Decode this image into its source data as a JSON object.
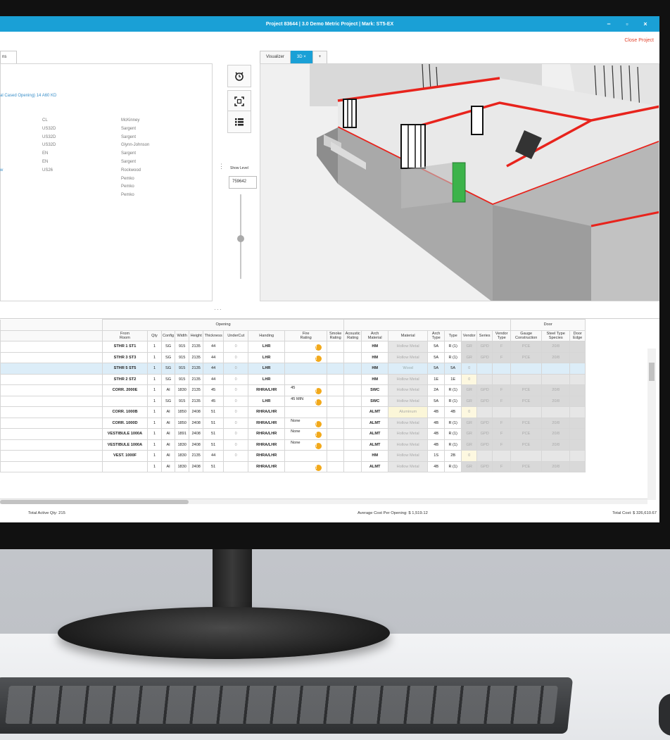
{
  "window": {
    "title": "Project 83644 | 3.0 Demo Metric Project | Mark: ST5-EX",
    "close_project": "Close Project",
    "minimize": "−",
    "maximize": "▫",
    "close": "×"
  },
  "left_panel": {
    "tab_label": "ns",
    "opening_link": "al Cased Opening) 14 A60 KD",
    "hardware": [
      {
        "finish": "CL",
        "mfr": "McKinney"
      },
      {
        "finish": "US32D",
        "mfr": "Sargent"
      },
      {
        "finish": "US32D",
        "mfr": "Sargent"
      },
      {
        "finish": "US32D",
        "mfr": "Glynn-Johnson"
      },
      {
        "finish": "EN",
        "mfr": "Sargent"
      },
      {
        "finish": "EN",
        "mfr": "Sargent"
      },
      {
        "finish": "US26",
        "mfr": "Rockwood",
        "lead": "w"
      },
      {
        "finish": "",
        "mfr": "Pemko"
      },
      {
        "finish": "",
        "mfr": "Pemko"
      },
      {
        "finish": "",
        "mfr": "Pemko"
      }
    ]
  },
  "tools": {
    "show_level_label": "Show Level",
    "show_level_value": "759642"
  },
  "visualizer": {
    "tabs": [
      "Visualizer",
      "3D ×",
      "+"
    ],
    "active_tab": 1
  },
  "table": {
    "group_opening": "Opening",
    "group_door": "Door",
    "headers": [
      "From\nRoom",
      "Qty",
      "Config",
      "Width",
      "Height",
      "Thickness",
      "UnderCut",
      "Handing",
      "Fire\nRating",
      "Smoke\nRating",
      "Acoustic\nRating",
      "Arch\nMaterial",
      "Material",
      "Arch\nType",
      "Type",
      "Vendor",
      "Series",
      "Vendor\nType",
      "Gauge\nConstruction",
      "Steel Type\nSpecies",
      "Door\nEdge"
    ],
    "rows": [
      {
        "from_room": "STHR 1 ST1",
        "qty": "1",
        "config": "SG",
        "width": "915",
        "height": "2135",
        "thickness": "44",
        "undercut": "0",
        "handing": "LHR",
        "fire": "",
        "fire_warn": true,
        "smoke": "",
        "acoustic": "",
        "arch_material": "HM",
        "material": "Hollow Metal",
        "arch_type": "5A",
        "type": "R (1)",
        "vendor": "GR",
        "series": "GPD",
        "vendor_type": "F",
        "gauge": "PCE",
        "steel": "20/8",
        "edge": "",
        "style": "gray"
      },
      {
        "from_room": "STHR 3 ST3",
        "qty": "1",
        "config": "SG",
        "width": "915",
        "height": "2135",
        "thickness": "44",
        "undercut": "0",
        "handing": "LHR",
        "fire": "",
        "fire_warn": true,
        "smoke": "",
        "acoustic": "",
        "arch_material": "HM",
        "material": "Hollow Metal",
        "arch_type": "5A",
        "type": "R (1)",
        "vendor": "GR",
        "series": "GPD",
        "vendor_type": "F",
        "gauge": "PCE",
        "steel": "20/8",
        "edge": "",
        "style": "gray"
      },
      {
        "from_room": "STHR 5 ST5",
        "qty": "1",
        "config": "SG",
        "width": "915",
        "height": "2135",
        "thickness": "44",
        "undercut": "0",
        "handing": "LHR",
        "fire": "",
        "fire_warn": false,
        "smoke": "",
        "acoustic": "",
        "arch_material": "HM",
        "material": "Wood",
        "arch_type": "5A",
        "type": "5A",
        "vendor": "0",
        "series": "",
        "vendor_type": "",
        "gauge": "",
        "steel": "",
        "edge": "",
        "style": "sel"
      },
      {
        "from_room": "STHR 2 ST2",
        "qty": "1",
        "config": "SG",
        "width": "915",
        "height": "2135",
        "thickness": "44",
        "undercut": "0",
        "handing": "LHR",
        "fire": "",
        "fire_warn": false,
        "smoke": "",
        "acoustic": "",
        "arch_material": "HM",
        "material": "Hollow Metal",
        "arch_type": "1E",
        "type": "1E",
        "vendor": "0",
        "series": "",
        "vendor_type": "",
        "gauge": "",
        "steel": "",
        "edge": "",
        "style": "plain"
      },
      {
        "from_room": "CORR. 2000E",
        "qty": "1",
        "config": "AI",
        "width": "1830",
        "height": "2135",
        "thickness": "45",
        "undercut": "0",
        "handing": "RHRA/LHR",
        "fire": "45",
        "fire_warn": true,
        "smoke": "",
        "acoustic": "",
        "arch_material": "SWC",
        "material": "Hollow Metal",
        "arch_type": "2A",
        "type": "R (1)",
        "vendor": "GR",
        "series": "GPD",
        "vendor_type": "F",
        "gauge": "PCE",
        "steel": "20/8",
        "edge": "",
        "style": "gray"
      },
      {
        "from_room": "",
        "qty": "1",
        "config": "SG",
        "width": "915",
        "height": "2135",
        "thickness": "45",
        "undercut": "0",
        "handing": "LHR",
        "fire": "45 MIN",
        "fire_warn": true,
        "smoke": "",
        "acoustic": "",
        "arch_material": "SWC",
        "material": "Hollow Metal",
        "arch_type": "5A",
        "type": "R (1)",
        "vendor": "GR",
        "series": "GPD",
        "vendor_type": "F",
        "gauge": "PCE",
        "steel": "20/8",
        "edge": "",
        "style": "gray"
      },
      {
        "from_room": "CORR. 1000B",
        "qty": "1",
        "config": "AI",
        "width": "1850",
        "height": "2408",
        "thickness": "51",
        "undercut": "0",
        "handing": "RHRA/LHR",
        "fire": "",
        "fire_warn": false,
        "smoke": "",
        "acoustic": "",
        "arch_material": "ALMT",
        "material": "Aluminum",
        "arch_type": "4B",
        "type": "4B",
        "vendor": "0",
        "series": "",
        "vendor_type": "",
        "gauge": "",
        "steel": "",
        "edge": "",
        "style": "alum"
      },
      {
        "from_room": "CORR. 1000D",
        "qty": "1",
        "config": "AI",
        "width": "1850",
        "height": "2408",
        "thickness": "51",
        "undercut": "0",
        "handing": "RHRA/LHR",
        "fire": "None",
        "fire_warn": true,
        "smoke": "",
        "acoustic": "",
        "arch_material": "ALMT",
        "material": "Hollow Metal",
        "arch_type": "4B",
        "type": "R (1)",
        "vendor": "GR",
        "series": "GPD",
        "vendor_type": "F",
        "gauge": "PCE",
        "steel": "20/8",
        "edge": "",
        "style": "gray"
      },
      {
        "from_room": "VESTIBULE 1000A",
        "qty": "1",
        "config": "AI",
        "width": "1891",
        "height": "2408",
        "thickness": "51",
        "undercut": "0",
        "handing": "RHRA/LHR",
        "fire": "None",
        "fire_warn": true,
        "smoke": "",
        "acoustic": "",
        "arch_material": "ALMT",
        "material": "Hollow Metal",
        "arch_type": "4B",
        "type": "R (1)",
        "vendor": "GR",
        "series": "GPD",
        "vendor_type": "F",
        "gauge": "PCE",
        "steel": "20/8",
        "edge": "",
        "style": "gray"
      },
      {
        "from_room": "VESTIBULE 1000A",
        "qty": "1",
        "config": "AI",
        "width": "1830",
        "height": "2408",
        "thickness": "51",
        "undercut": "0",
        "handing": "RHRA/LHR",
        "fire": "None",
        "fire_warn": true,
        "smoke": "",
        "acoustic": "",
        "arch_material": "ALMT",
        "material": "Hollow Metal",
        "arch_type": "4B",
        "type": "R (1)",
        "vendor": "GR",
        "series": "GPD",
        "vendor_type": "F",
        "gauge": "PCE",
        "steel": "20/8",
        "edge": "",
        "style": "gray"
      },
      {
        "from_room": "VEST. 1000F",
        "qty": "1",
        "config": "AI",
        "width": "1830",
        "height": "2135",
        "thickness": "44",
        "undercut": "0",
        "handing": "RHRA/LHR",
        "fire": "",
        "fire_warn": false,
        "smoke": "",
        "acoustic": "",
        "arch_material": "HM",
        "material": "Hollow Metal",
        "arch_type": "1S",
        "type": "2B",
        "vendor": "0",
        "series": "",
        "vendor_type": "",
        "gauge": "",
        "steel": "",
        "edge": "",
        "style": "vwarn"
      },
      {
        "from_room": "",
        "qty": "1",
        "config": "AI",
        "width": "1830",
        "height": "2408",
        "thickness": "51",
        "undercut": "",
        "handing": "RHRA/LHR",
        "fire": "",
        "fire_warn": true,
        "smoke": "",
        "acoustic": "",
        "arch_material": "ALMT",
        "material": "Hollow Metal",
        "arch_type": "4B",
        "type": "R (1)",
        "vendor": "GR",
        "series": "GPD",
        "vendor_type": "F",
        "gauge": "PCE",
        "steel": "20/8",
        "edge": "",
        "style": "gray"
      }
    ]
  },
  "footer": {
    "total_qty": "Total Active Qty: 215",
    "avg_cost": "Average Cost Per Opening: $ 1,519.12",
    "total_cost": "Total Cost: $  326,610.67"
  },
  "colors": {
    "accent": "#1aa0d6",
    "warning": "#f2a91b",
    "close_project": "#e2452f",
    "wall_red": "#e8231c",
    "door_green": "#3cb34a"
  }
}
